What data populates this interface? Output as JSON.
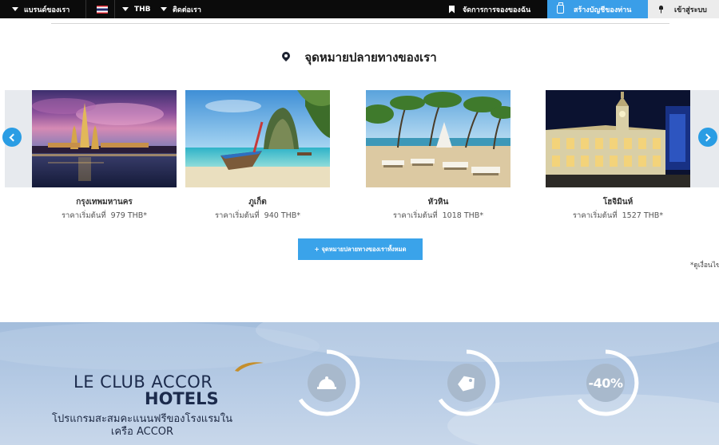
{
  "topbar": {
    "brands": "แบรนด์ของเรา",
    "currency": "THB",
    "contact": "ติดต่อเรา",
    "manage_booking": "จัดการการจองของฉัน",
    "create_account": "สร้างบัญชีของท่าน",
    "login": "เข้าสู่ระบบ"
  },
  "destinations": {
    "title": "จุดหมายปลายทางของเรา",
    "price_prefix": "ราคาเริ่มต้นที่",
    "currency": "THB*",
    "items": [
      {
        "name": "กรุงเทพมหานคร",
        "price": "979"
      },
      {
        "name": "ภูเก็ต",
        "price": "940"
      },
      {
        "name": "หัวหิน",
        "price": "1018"
      },
      {
        "name": "โฮจิมินห์",
        "price": "1527"
      }
    ],
    "all_button": "+ จุดหมายปลายทางของเราทั้งหมด",
    "footnote": "*ดูเงื่อนไข"
  },
  "club": {
    "logo_line1": "LE CLUB ACCOR",
    "logo_line2": "HOTELS",
    "description": "โปรแกรมสะสมคะแนนฟรีของโรงแรมใน เครือ ACCOR",
    "benefits": [
      {
        "icon": "cloche-icon"
      },
      {
        "icon": "price-tag-icon"
      },
      {
        "icon": "discount-icon",
        "label": "-40%"
      }
    ]
  },
  "colors": {
    "accent": "#3a9ee8",
    "topbar": "#0b0b0b",
    "navy": "#1c2b4c"
  }
}
